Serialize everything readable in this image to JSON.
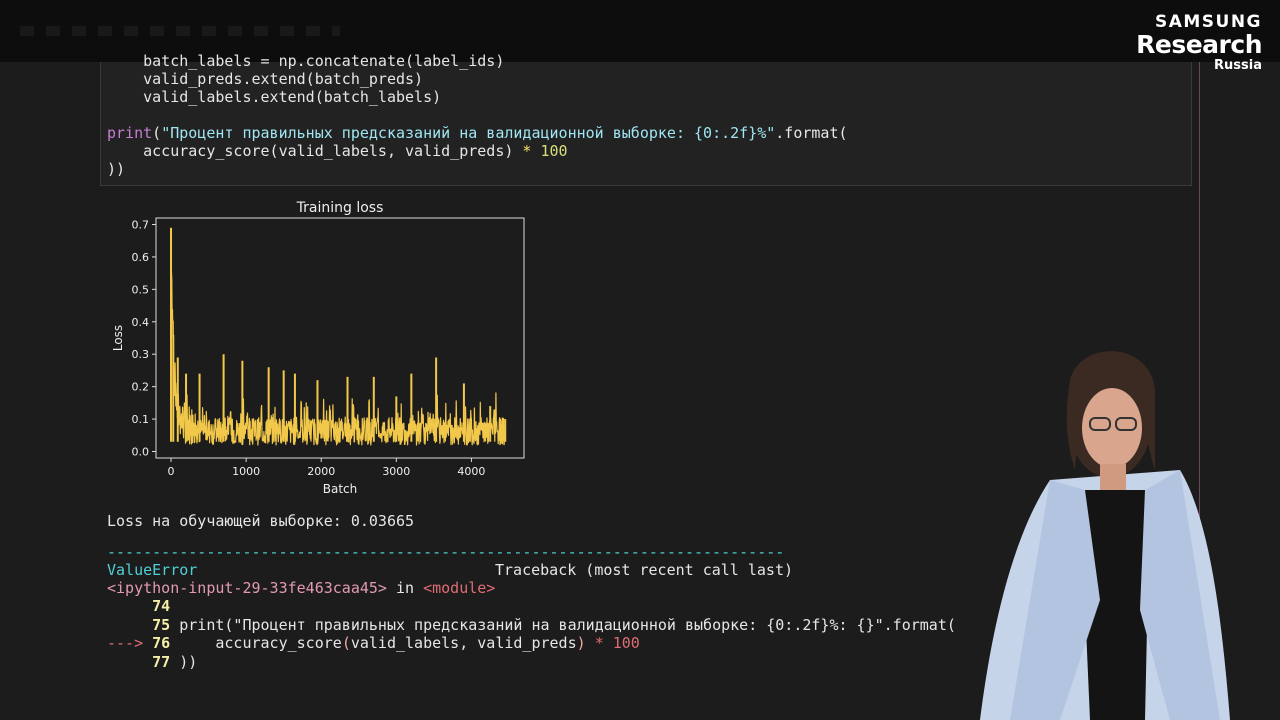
{
  "watermark": {
    "brand": "SAMSUNG",
    "name": "Research",
    "region": "Russia"
  },
  "code_cell": {
    "lines": [
      "    batch_labels = np.concatenate(label_ids)",
      "    valid_preds.extend(batch_preds)",
      "    valid_labels.extend(batch_labels)",
      "",
      "print(\"Процент правильных предсказаний на валидационной выборке: {0:.2f}%\".format(",
      "    accuracy_score(valid_labels, valid_preds) * 100",
      "))"
    ]
  },
  "chart_data": {
    "type": "line",
    "title": "Training loss",
    "xlabel": "Batch",
    "ylabel": "Loss",
    "xlim": [
      -200,
      4700
    ],
    "ylim": [
      -0.02,
      0.72
    ],
    "xticks": [
      "0",
      "1000",
      "2000",
      "3000",
      "4000"
    ],
    "yticks": [
      "0.0",
      "0.1",
      "0.2",
      "0.3",
      "0.4",
      "0.5",
      "0.6",
      "0.7"
    ],
    "line_color": "#f2c84b",
    "peaks": [
      {
        "x": 0,
        "y": 0.69
      },
      {
        "x": 30,
        "y": 0.36
      },
      {
        "x": 90,
        "y": 0.29
      },
      {
        "x": 200,
        "y": 0.24
      },
      {
        "x": 380,
        "y": 0.24
      },
      {
        "x": 700,
        "y": 0.3
      },
      {
        "x": 950,
        "y": 0.28
      },
      {
        "x": 1300,
        "y": 0.26
      },
      {
        "x": 1500,
        "y": 0.25
      },
      {
        "x": 1650,
        "y": 0.24
      },
      {
        "x": 1950,
        "y": 0.22
      },
      {
        "x": 2350,
        "y": 0.23
      },
      {
        "x": 2700,
        "y": 0.23
      },
      {
        "x": 3000,
        "y": 0.17
      },
      {
        "x": 3200,
        "y": 0.24
      },
      {
        "x": 3530,
        "y": 0.29
      },
      {
        "x": 3900,
        "y": 0.21
      },
      {
        "x": 4250,
        "y": 0.14
      },
      {
        "x": 4450,
        "y": 0.1
      }
    ]
  },
  "output": {
    "loss_line": "Loss на обучающей выборке: 0.03665",
    "dash_line": "---------------------------------------------------------------------------",
    "error_name": "ValueError",
    "traceback_header": "Traceback (most recent call last)",
    "input_ref": "<ipython-input-29-33fe463caa45>",
    "in_word": " in ",
    "module_ref": "<module>",
    "trace_lines": [
      {
        "prefix": "     ",
        "num": "74",
        "code": ""
      },
      {
        "prefix": "     ",
        "num": "75",
        "code": " print(\"Процент правильных предсказаний на валидационной выборке: {0:.2f}%: {}\".format("
      },
      {
        "prefix": "---> ",
        "num": "76",
        "code": "     accuracy_score(valid_labels, valid_preds) * 100"
      },
      {
        "prefix": "     ",
        "num": "77",
        "code": " ))"
      }
    ]
  }
}
